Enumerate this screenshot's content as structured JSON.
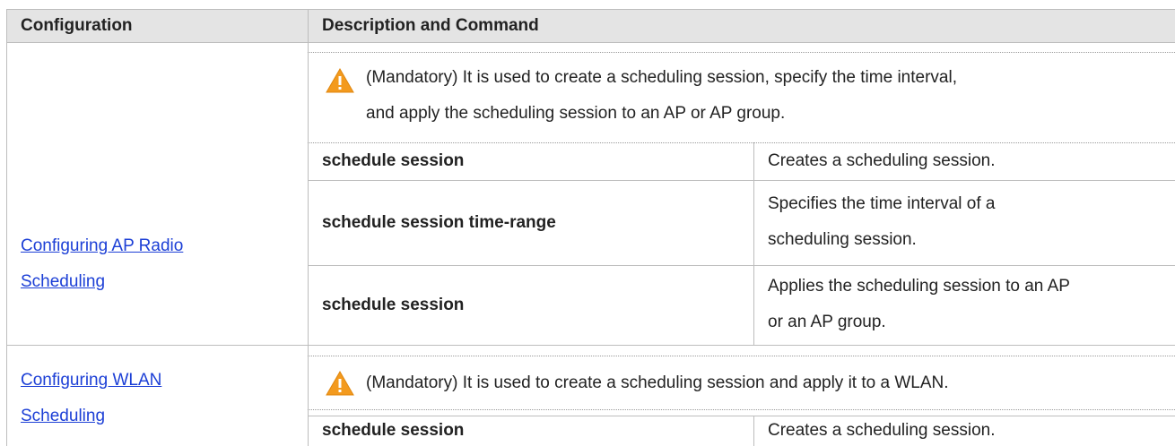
{
  "header": {
    "col1": "Configuration",
    "col2": "Description and Command"
  },
  "sections": [
    {
      "config_link": [
        "Configuring AP Radio ",
        "Scheduling"
      ],
      "note": [
        "(Mandatory) It is used to create a scheduling session, specify the time interval,",
        "and apply the scheduling session to an AP or AP group."
      ],
      "note_icon": "warning-triangle-icon",
      "rows": [
        {
          "command": "schedule session",
          "description": [
            "Creates a scheduling session."
          ]
        },
        {
          "command": "schedule session time-range",
          "description": [
            "Specifies the time interval of a",
            "scheduling session."
          ]
        },
        {
          "command": "schedule session",
          "description": [
            "Applies the scheduling session to an AP",
            "or an AP group."
          ]
        }
      ]
    },
    {
      "config_link": [
        "Configuring WLAN ",
        "Scheduling"
      ],
      "note": [
        "(Mandatory) It is used to create a scheduling session and apply it to a WLAN."
      ],
      "note_icon": "warning-triangle-icon",
      "rows": [
        {
          "command": "schedule session",
          "description": [
            "Creates a scheduling session."
          ]
        }
      ]
    }
  ],
  "colors": {
    "header_bg": "#e4e4e4",
    "link": "#1c3fd6",
    "warning": "#f39a1e",
    "border": "#bdbdbd"
  }
}
